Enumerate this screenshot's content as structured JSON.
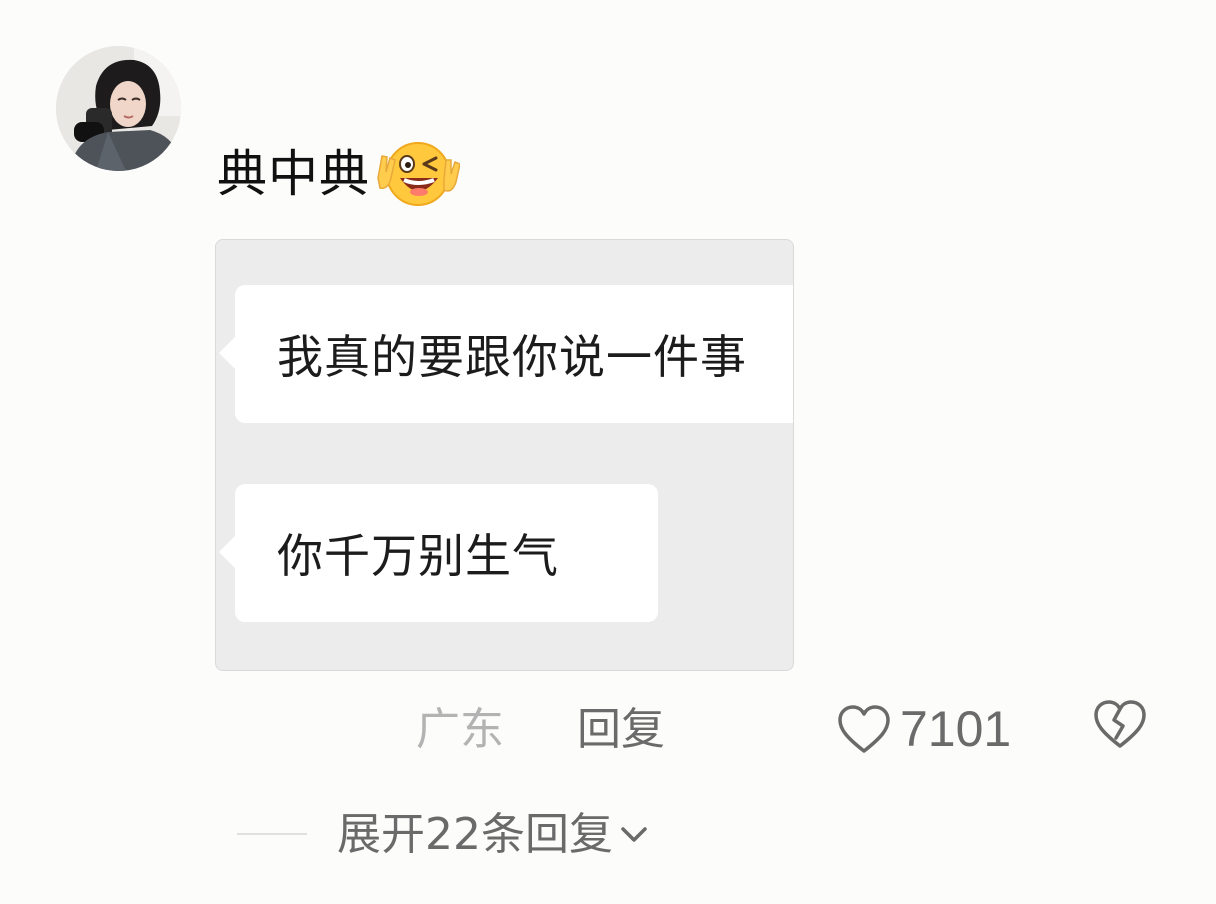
{
  "comment": {
    "avatar_icon": "user-avatar-photo",
    "text": "典中典",
    "emoji_icon": "winking-laughing-face-emoji"
  },
  "attached_image": {
    "messages": [
      {
        "text": "我真的要跟你说一件事"
      },
      {
        "text": "你千万别生气"
      }
    ]
  },
  "meta": {
    "location": "广东",
    "reply_label": "回复",
    "like_icon": "heart-outline-icon",
    "like_count": "7101",
    "dislike_icon": "broken-heart-icon"
  },
  "replies": {
    "expand_label": "展开22条回复",
    "chevron_icon": "chevron-down-icon"
  },
  "colors": {
    "background": "#fcfcfb",
    "primary_text": "#111111",
    "secondary_text": "#6a6a6a",
    "muted_text": "#b3b3b3",
    "chat_background": "#ececec",
    "bubble": "#ffffff"
  }
}
